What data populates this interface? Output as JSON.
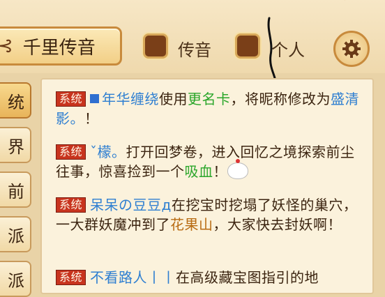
{
  "header": {
    "channel_title": "千里传音",
    "title_glyph": "⊰",
    "options": [
      {
        "label": "传音",
        "checked": false
      },
      {
        "label": "个人",
        "checked": false
      }
    ]
  },
  "channel_tabs": [
    {
      "label": "统",
      "active": true
    },
    {
      "label": "界",
      "active": false
    },
    {
      "label": "前",
      "active": false
    },
    {
      "label": "派",
      "active": false
    },
    {
      "label": "派",
      "active": false
    }
  ],
  "messages": [
    {
      "tag": "系统",
      "parts": [
        {
          "text": "年华缠绕",
          "style": "blue",
          "prefix_square": true
        },
        {
          "text": "使用",
          "style": "plain"
        },
        {
          "text": "更名卡",
          "style": "green"
        },
        {
          "text": "，将昵称修改为",
          "style": "plain"
        },
        {
          "text": "盛清影。",
          "style": "blue"
        },
        {
          "text": "！",
          "style": "plain"
        }
      ]
    },
    {
      "tag": "系统",
      "parts": [
        {
          "text": "ˇ檬。",
          "style": "blue"
        },
        {
          "text": "打开回梦卷，进入回忆之境探索前尘往事，惊喜捡到一个",
          "style": "plain"
        },
        {
          "text": "吸血",
          "style": "green"
        },
        {
          "text": "！",
          "style": "plain"
        }
      ],
      "emoji": "buns-icon"
    },
    {
      "tag": "系统",
      "parts": [
        {
          "text": "呆呆の豆豆д",
          "style": "blue"
        },
        {
          "text": "在挖宝时挖塌了妖怪的巢穴，一大群妖魔冲到了",
          "style": "plain"
        },
        {
          "text": "花果山",
          "style": "orange"
        },
        {
          "text": "，大家快去封妖啊！",
          "style": "plain"
        }
      ]
    },
    {
      "tag": "系统",
      "parts": [
        {
          "text": "不看路人丨丨",
          "style": "blue"
        },
        {
          "text": "在高级藏宝图指引的地",
          "style": "plain"
        }
      ]
    }
  ]
}
